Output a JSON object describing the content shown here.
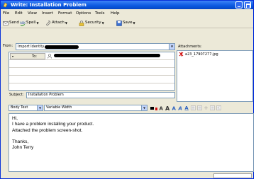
{
  "window": {
    "title": "Write: Installation Problem"
  },
  "menu": [
    "File",
    "Edit",
    "View",
    "Insert",
    "Format",
    "Options",
    "Tools",
    "Help"
  ],
  "toolbar": {
    "send": "Send",
    "spell": "Spell",
    "attach": "Attach",
    "security": "Security",
    "save": "Save"
  },
  "header": {
    "from_label": "From:",
    "from_value": "Import Identity",
    "to_label": "To:",
    "subject_label": "Subject:",
    "subject_value": "Installation Problem"
  },
  "attachments": {
    "label": "Attachments:",
    "items": [
      "a23_17907277.jpg"
    ]
  },
  "format": {
    "paragraph": "Body Text",
    "font": "Variable Width"
  },
  "body": {
    "lines": [
      "Hi,",
      "I have a problem installing your product.",
      "Attached the problem screen-shot.",
      "",
      "Thanks,",
      "John Terry"
    ]
  },
  "colors": {
    "titlebar": "#0a58e0",
    "redaction": "#000000",
    "attachment_icon": "#d01010"
  }
}
